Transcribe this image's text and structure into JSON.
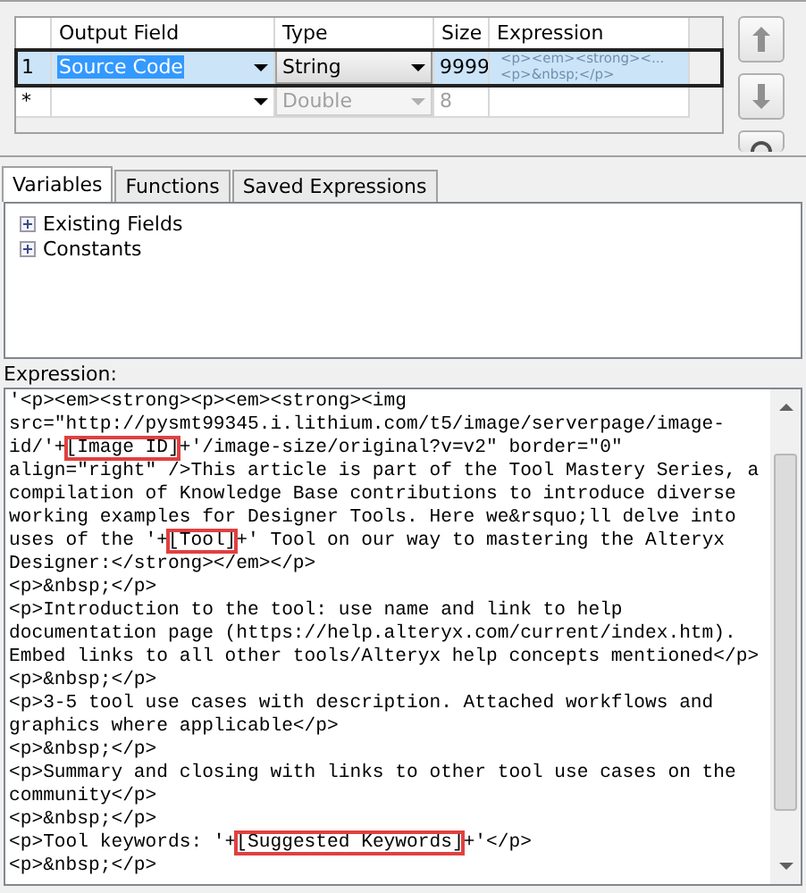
{
  "fields_grid": {
    "columns": [
      "Output Field",
      "Type",
      "Size",
      "Expression"
    ],
    "rows": [
      {
        "marker": "1",
        "selected": true,
        "disabled": false,
        "output_field": "Source Code",
        "type": "String",
        "size": "9999",
        "expression": [
          "<p><em><strong><...",
          "<p>&nbsp;</p>"
        ]
      },
      {
        "marker": "*",
        "selected": false,
        "disabled": true,
        "output_field": "",
        "type": "Double",
        "size": "8",
        "expression": []
      }
    ]
  },
  "tabs": [
    {
      "label": "Variables",
      "selected": true
    },
    {
      "label": "Functions",
      "selected": false
    },
    {
      "label": "Saved Expressions",
      "selected": false
    }
  ],
  "tree": [
    {
      "label": "Existing Fields",
      "expanded": false
    },
    {
      "label": "Constants",
      "expanded": false
    }
  ],
  "expression_label": "Expression:",
  "expression_lines": [
    [
      {
        "kind": "text",
        "text": "'<p><em><strong><p><em><strong><img"
      }
    ],
    [
      {
        "kind": "text",
        "text": "src=\"http://pysmt99345.i.lithium.com/t5/image/serverpage/image-"
      }
    ],
    [
      {
        "kind": "text",
        "text": "id/'+"
      },
      {
        "kind": "field",
        "text": "[Image ID]"
      },
      {
        "kind": "text",
        "text": "+'/image-size/original?v=v2\" border=\"0\""
      }
    ],
    [
      {
        "kind": "text",
        "text": "align=\"right\" />This article is part of the Tool Mastery Series, a"
      }
    ],
    [
      {
        "kind": "text",
        "text": "compilation of Knowledge Base contributions to introduce diverse"
      }
    ],
    [
      {
        "kind": "text",
        "text": "working examples for Designer Tools. Here we&rsquo;ll delve into"
      }
    ],
    [
      {
        "kind": "text",
        "text": "uses of the '+"
      },
      {
        "kind": "field",
        "text": "[Tool]"
      },
      {
        "kind": "text",
        "text": "+' Tool on our way to mastering the Alteryx"
      }
    ],
    [
      {
        "kind": "text",
        "text": "Designer:</strong></em></p>"
      }
    ],
    [
      {
        "kind": "text",
        "text": "<p>&nbsp;</p>"
      }
    ],
    [
      {
        "kind": "text",
        "text": "<p>Introduction to the tool: use name and link to help"
      }
    ],
    [
      {
        "kind": "text",
        "text": "documentation page (https://help.alteryx.com/current/index.htm)."
      }
    ],
    [
      {
        "kind": "text",
        "text": "Embed links to all other tools/Alteryx help concepts mentioned</p>"
      }
    ],
    [
      {
        "kind": "text",
        "text": "<p>&nbsp;</p>"
      }
    ],
    [
      {
        "kind": "text",
        "text": "<p>3-5 tool use cases with description. Attached workflows and"
      }
    ],
    [
      {
        "kind": "text",
        "text": "graphics where applicable</p>"
      }
    ],
    [
      {
        "kind": "text",
        "text": "<p>&nbsp;</p>"
      }
    ],
    [
      {
        "kind": "text",
        "text": "<p>Summary and closing with links to other tool use cases on the"
      }
    ],
    [
      {
        "kind": "text",
        "text": "community</p>"
      }
    ],
    [
      {
        "kind": "text",
        "text": "<p>&nbsp;</p>"
      }
    ],
    [
      {
        "kind": "text",
        "text": "<p>Tool keywords: '+"
      },
      {
        "kind": "field",
        "text": "[Suggested Keywords]"
      },
      {
        "kind": "text",
        "text": "+'</p>"
      }
    ],
    [
      {
        "kind": "text",
        "text": "<p>&nbsp;</p>"
      }
    ]
  ]
}
